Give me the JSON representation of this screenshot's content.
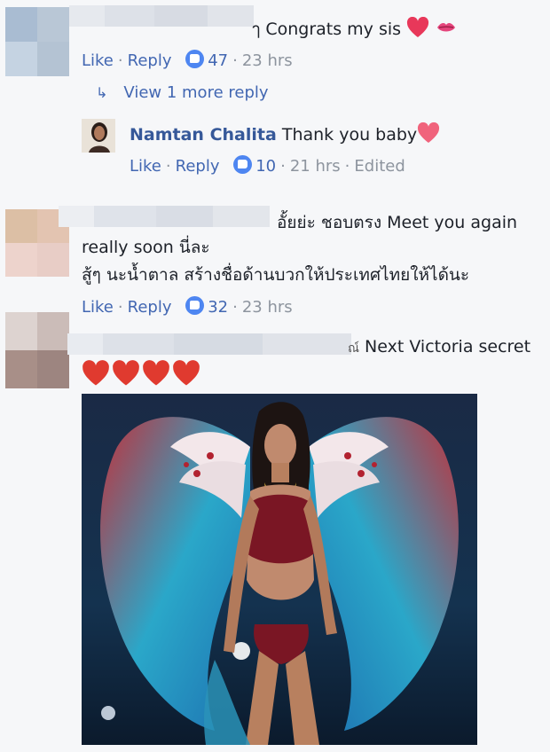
{
  "comments": [
    {
      "text": "Congrats my sis",
      "like_label": "Like",
      "reply_label": "Reply",
      "like_count": "47",
      "time": "23 hrs",
      "view_more": "View 1 more reply"
    },
    {
      "author": "Namtan Chalita",
      "text": "Thank you baby",
      "like_label": "Like",
      "reply_label": "Reply",
      "like_count": "10",
      "time": "21 hrs",
      "edited": "Edited"
    },
    {
      "line1": "อั้ยย่ะ ชอบตรง Meet you again",
      "line2": "really soon นี่ละ",
      "line3": "สู้ๆ นะน้ำตาล สร้างชื่อด้านบวกให้ประเทศไทยให้ได้นะ",
      "like_label": "Like",
      "reply_label": "Reply",
      "like_count": "32",
      "time": "23 hrs"
    },
    {
      "text_prefix": "ณ์",
      "text": "Next Victoria secret"
    }
  ],
  "colors": {
    "link": "#4267b2",
    "name": "#365899",
    "meta": "#8d949e",
    "like_badge": "#4e86f1",
    "heart": "#e8385a"
  },
  "icons": [
    "heart-icon",
    "kiss-icon",
    "like-thumb-icon",
    "reply-arrow-icon"
  ]
}
